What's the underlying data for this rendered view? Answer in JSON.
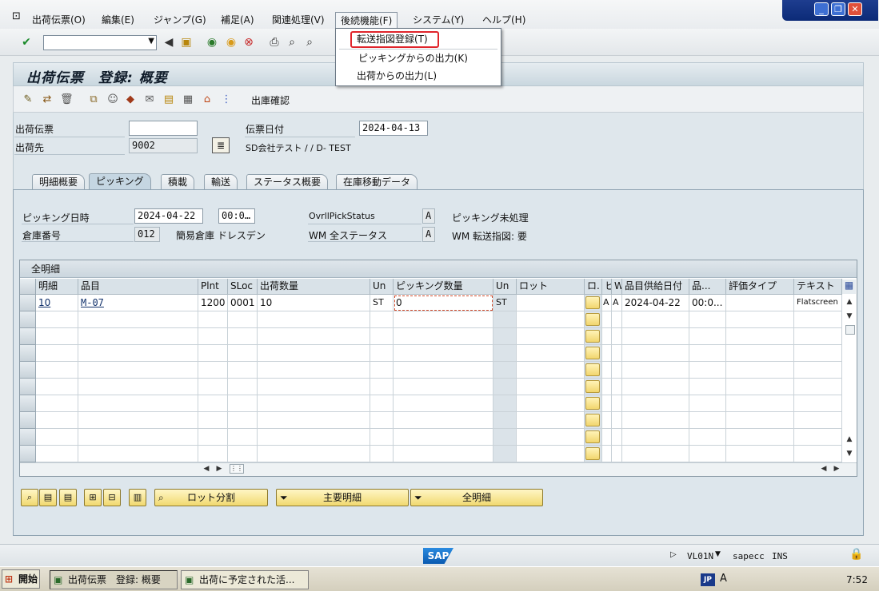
{
  "menubar": {
    "items": [
      "出荷伝票(O)",
      "編集(E)",
      "ジャンプ(G)",
      "補足(A)",
      "関連処理(V)",
      "後続機能(F)",
      "システム(Y)",
      "ヘルプ(H)"
    ]
  },
  "dropdown": {
    "items": [
      "転送指図登録(T)",
      "ピッキングからの出力(K)",
      "出荷からの出力(L)"
    ]
  },
  "page": {
    "title": "出荷伝票　登録: 概要"
  },
  "toolbar2": {
    "label": "出庫確認"
  },
  "header": {
    "delivery_label": "出荷伝票",
    "delivery_value": "",
    "shipto_label": "出荷先",
    "shipto_value": "9002",
    "date_label": "伝票日付",
    "date_value": "2024-04-13",
    "shipto_desc": "SD会社テスト / / D- TEST"
  },
  "tabs": [
    "明細概要",
    "ピッキング",
    "積載",
    "輸送",
    "ステータス概要",
    "在庫移動データ"
  ],
  "picking": {
    "date_label": "ピッキング日時",
    "date_value": "2024-04-22",
    "time_value": "00:0…",
    "warehouse_label": "倉庫番号",
    "warehouse_value": "012",
    "warehouse_desc": "簡易倉庫 ドレスデン",
    "ovrl_label": "OvrllPickStatus",
    "ovrl_value": "A",
    "ovrl_desc": "ピッキング未処理",
    "wm_label": "WM 全ステータス",
    "wm_value": "A",
    "wm_desc": "WM 転送指図: 要"
  },
  "table": {
    "title": "全明細",
    "headers": [
      "明細",
      "品目",
      "Plnt",
      "SLoc",
      "出荷数量",
      "Un",
      "ピッキング数量",
      "Un",
      "ロット",
      "ロ.",
      "ヒ",
      "W.",
      "品目供給日付",
      "品...",
      "評価タイプ",
      "テキスト"
    ],
    "row1": {
      "item": "10",
      "material": "M-07",
      "plant": "1200",
      "sloc": "0001",
      "qty": "10",
      "un": "ST",
      "pickqty": "0",
      "un2": "ST",
      "h": "A",
      "w": "A",
      "date": "2024-04-22",
      "time": "00:0...",
      "text": "Flatscreen"
    }
  },
  "buttons": {
    "batch": "ロット分割",
    "main": "主要明細",
    "all": "全明細"
  },
  "status": {
    "tcode": "VL01N",
    "server": "sapecc",
    "mode": "INS"
  },
  "taskbar": {
    "start": "開始",
    "task1": "出荷伝票　登録: 概要",
    "task2": "出荷に予定された活...",
    "lang": "JP",
    "clock": "7:52"
  }
}
